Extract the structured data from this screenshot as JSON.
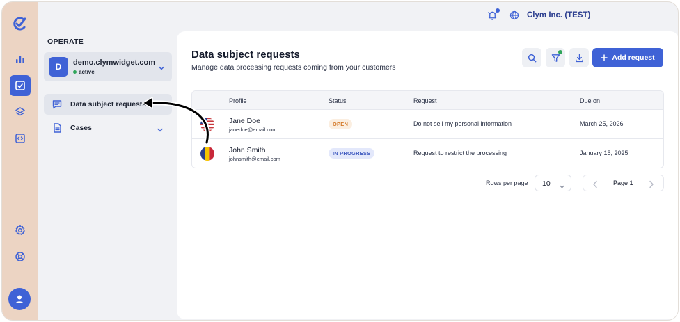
{
  "header": {
    "org_label": "Clym Inc. (TEST)",
    "icons": [
      "bell-icon",
      "globe-icon"
    ]
  },
  "rail": {
    "icons": [
      "clym-logo-icon",
      "bar-chart-icon",
      "checklist-icon",
      "layers-icon",
      "code-icon",
      "gear-icon",
      "lifebuoy-icon",
      "user-avatar-icon"
    ],
    "active_index": 2
  },
  "sidenav": {
    "section_label": "OPERATE",
    "site": {
      "initial": "D",
      "domain": "demo.clymwidget.com",
      "status": "active"
    },
    "items": [
      {
        "label": "Data subject requests",
        "icon": "chat-icon",
        "active": true
      },
      {
        "label": "Cases",
        "icon": "document-icon",
        "active": false
      }
    ]
  },
  "main": {
    "title": "Data subject requests",
    "subtitle": "Manage data processing requests coming from your customers",
    "add_button_label": "Add request",
    "table": {
      "columns": [
        "Profile",
        "Status",
        "Request",
        "Due on"
      ],
      "rows": [
        {
          "name": "Jane Doe",
          "email": "janedoe@email.com",
          "flag": "us-flag-icon",
          "status": "OPEN",
          "request": "Do not sell my personal information",
          "due": "March 25, 2026"
        },
        {
          "name": "John Smith",
          "email": "johnsmith@email.com",
          "flag": "ro-flag-icon",
          "status": "IN PROGRESS",
          "request": "Request to restrict the processing",
          "due": "January 15, 2025"
        }
      ]
    },
    "pagination": {
      "rows_per_page_label": "Rows per page",
      "rows_per_page_value": "10",
      "page_label": "Page 1"
    }
  },
  "colors": {
    "accent": "#3f62d6",
    "rail_bg": "#ecd4c3",
    "status_active": "#2fa55a",
    "pill_open_text": "#d47a2a",
    "pill_progress_text": "#3d58bf"
  }
}
